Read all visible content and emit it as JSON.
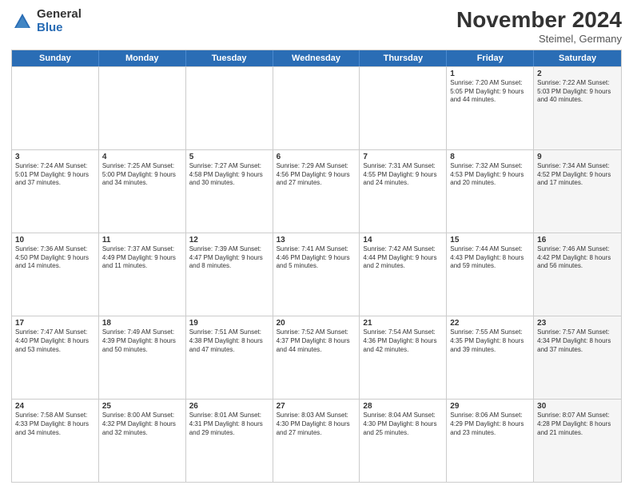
{
  "header": {
    "logo_general": "General",
    "logo_blue": "Blue",
    "month_title": "November 2024",
    "location": "Steimel, Germany"
  },
  "days_of_week": [
    "Sunday",
    "Monday",
    "Tuesday",
    "Wednesday",
    "Thursday",
    "Friday",
    "Saturday"
  ],
  "weeks": [
    [
      {
        "day": "",
        "info": "",
        "shaded": false
      },
      {
        "day": "",
        "info": "",
        "shaded": false
      },
      {
        "day": "",
        "info": "",
        "shaded": false
      },
      {
        "day": "",
        "info": "",
        "shaded": false
      },
      {
        "day": "",
        "info": "",
        "shaded": false
      },
      {
        "day": "1",
        "info": "Sunrise: 7:20 AM\nSunset: 5:05 PM\nDaylight: 9 hours and 44 minutes.",
        "shaded": false
      },
      {
        "day": "2",
        "info": "Sunrise: 7:22 AM\nSunset: 5:03 PM\nDaylight: 9 hours and 40 minutes.",
        "shaded": true
      }
    ],
    [
      {
        "day": "3",
        "info": "Sunrise: 7:24 AM\nSunset: 5:01 PM\nDaylight: 9 hours and 37 minutes.",
        "shaded": false
      },
      {
        "day": "4",
        "info": "Sunrise: 7:25 AM\nSunset: 5:00 PM\nDaylight: 9 hours and 34 minutes.",
        "shaded": false
      },
      {
        "day": "5",
        "info": "Sunrise: 7:27 AM\nSunset: 4:58 PM\nDaylight: 9 hours and 30 minutes.",
        "shaded": false
      },
      {
        "day": "6",
        "info": "Sunrise: 7:29 AM\nSunset: 4:56 PM\nDaylight: 9 hours and 27 minutes.",
        "shaded": false
      },
      {
        "day": "7",
        "info": "Sunrise: 7:31 AM\nSunset: 4:55 PM\nDaylight: 9 hours and 24 minutes.",
        "shaded": false
      },
      {
        "day": "8",
        "info": "Sunrise: 7:32 AM\nSunset: 4:53 PM\nDaylight: 9 hours and 20 minutes.",
        "shaded": false
      },
      {
        "day": "9",
        "info": "Sunrise: 7:34 AM\nSunset: 4:52 PM\nDaylight: 9 hours and 17 minutes.",
        "shaded": true
      }
    ],
    [
      {
        "day": "10",
        "info": "Sunrise: 7:36 AM\nSunset: 4:50 PM\nDaylight: 9 hours and 14 minutes.",
        "shaded": false
      },
      {
        "day": "11",
        "info": "Sunrise: 7:37 AM\nSunset: 4:49 PM\nDaylight: 9 hours and 11 minutes.",
        "shaded": false
      },
      {
        "day": "12",
        "info": "Sunrise: 7:39 AM\nSunset: 4:47 PM\nDaylight: 9 hours and 8 minutes.",
        "shaded": false
      },
      {
        "day": "13",
        "info": "Sunrise: 7:41 AM\nSunset: 4:46 PM\nDaylight: 9 hours and 5 minutes.",
        "shaded": false
      },
      {
        "day": "14",
        "info": "Sunrise: 7:42 AM\nSunset: 4:44 PM\nDaylight: 9 hours and 2 minutes.",
        "shaded": false
      },
      {
        "day": "15",
        "info": "Sunrise: 7:44 AM\nSunset: 4:43 PM\nDaylight: 8 hours and 59 minutes.",
        "shaded": false
      },
      {
        "day": "16",
        "info": "Sunrise: 7:46 AM\nSunset: 4:42 PM\nDaylight: 8 hours and 56 minutes.",
        "shaded": true
      }
    ],
    [
      {
        "day": "17",
        "info": "Sunrise: 7:47 AM\nSunset: 4:40 PM\nDaylight: 8 hours and 53 minutes.",
        "shaded": false
      },
      {
        "day": "18",
        "info": "Sunrise: 7:49 AM\nSunset: 4:39 PM\nDaylight: 8 hours and 50 minutes.",
        "shaded": false
      },
      {
        "day": "19",
        "info": "Sunrise: 7:51 AM\nSunset: 4:38 PM\nDaylight: 8 hours and 47 minutes.",
        "shaded": false
      },
      {
        "day": "20",
        "info": "Sunrise: 7:52 AM\nSunset: 4:37 PM\nDaylight: 8 hours and 44 minutes.",
        "shaded": false
      },
      {
        "day": "21",
        "info": "Sunrise: 7:54 AM\nSunset: 4:36 PM\nDaylight: 8 hours and 42 minutes.",
        "shaded": false
      },
      {
        "day": "22",
        "info": "Sunrise: 7:55 AM\nSunset: 4:35 PM\nDaylight: 8 hours and 39 minutes.",
        "shaded": false
      },
      {
        "day": "23",
        "info": "Sunrise: 7:57 AM\nSunset: 4:34 PM\nDaylight: 8 hours and 37 minutes.",
        "shaded": true
      }
    ],
    [
      {
        "day": "24",
        "info": "Sunrise: 7:58 AM\nSunset: 4:33 PM\nDaylight: 8 hours and 34 minutes.",
        "shaded": false
      },
      {
        "day": "25",
        "info": "Sunrise: 8:00 AM\nSunset: 4:32 PM\nDaylight: 8 hours and 32 minutes.",
        "shaded": false
      },
      {
        "day": "26",
        "info": "Sunrise: 8:01 AM\nSunset: 4:31 PM\nDaylight: 8 hours and 29 minutes.",
        "shaded": false
      },
      {
        "day": "27",
        "info": "Sunrise: 8:03 AM\nSunset: 4:30 PM\nDaylight: 8 hours and 27 minutes.",
        "shaded": false
      },
      {
        "day": "28",
        "info": "Sunrise: 8:04 AM\nSunset: 4:30 PM\nDaylight: 8 hours and 25 minutes.",
        "shaded": false
      },
      {
        "day": "29",
        "info": "Sunrise: 8:06 AM\nSunset: 4:29 PM\nDaylight: 8 hours and 23 minutes.",
        "shaded": false
      },
      {
        "day": "30",
        "info": "Sunrise: 8:07 AM\nSunset: 4:28 PM\nDaylight: 8 hours and 21 minutes.",
        "shaded": true
      }
    ]
  ]
}
